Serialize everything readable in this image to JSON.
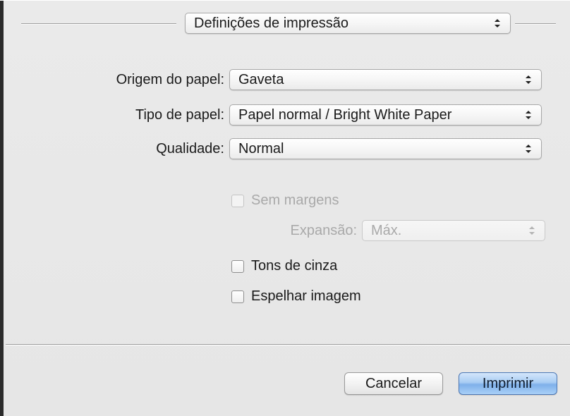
{
  "header": {
    "panel_select": "Definições de impressão"
  },
  "form": {
    "paper_source": {
      "label": "Origem do papel:",
      "value": "Gaveta"
    },
    "paper_type": {
      "label": "Tipo de papel:",
      "value": "Papel normal / Bright White Paper"
    },
    "quality": {
      "label": "Qualidade:",
      "value": "Normal"
    }
  },
  "options": {
    "borderless": {
      "label": "Sem margens",
      "enabled": false,
      "checked": false
    },
    "expansion": {
      "label": "Expansão:",
      "value": "Máx.",
      "enabled": false
    },
    "grayscale": {
      "label": "Tons de cinza",
      "checked": false
    },
    "mirror_image": {
      "label": "Espelhar imagem",
      "checked": false
    }
  },
  "footer": {
    "cancel_label": "Cancelar",
    "print_label": "Imprimir"
  },
  "colors": {
    "accent": "#7fb0ea",
    "disabled_text": "#a9a9a9",
    "background": "#ececec"
  }
}
